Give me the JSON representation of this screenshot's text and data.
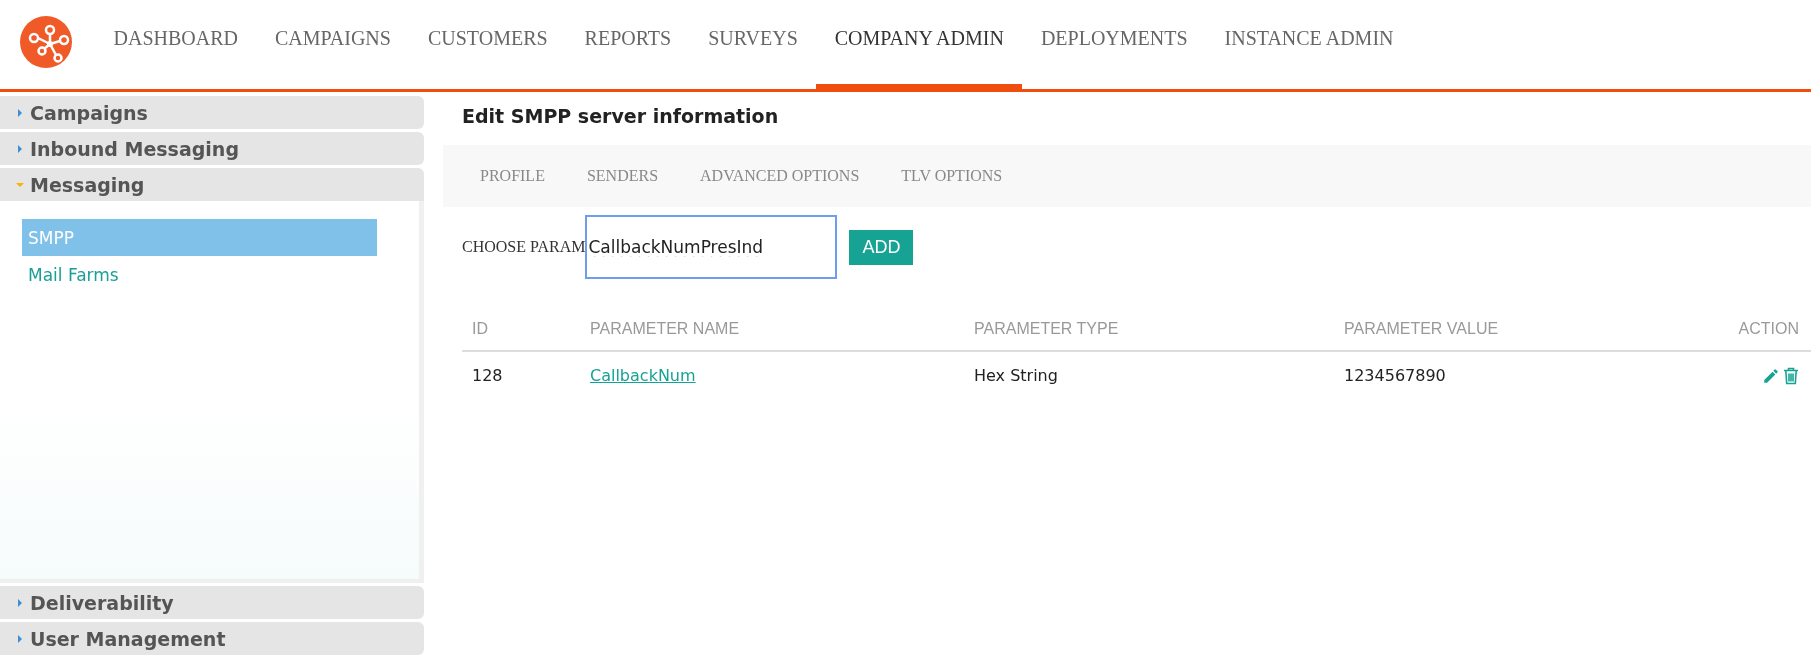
{
  "nav": {
    "items": [
      {
        "label": "DASHBOARD",
        "selected": false
      },
      {
        "label": "CAMPAIGNS",
        "selected": false
      },
      {
        "label": "CUSTOMERS",
        "selected": false
      },
      {
        "label": "REPORTS",
        "selected": false
      },
      {
        "label": "SURVEYS",
        "selected": false
      },
      {
        "label": "COMPANY ADMIN",
        "selected": true
      },
      {
        "label": "DEPLOYMENTS",
        "selected": false
      },
      {
        "label": "INSTANCE ADMIN",
        "selected": false
      }
    ]
  },
  "sidebar": {
    "sections": [
      {
        "label": "Campaigns",
        "expanded": false
      },
      {
        "label": "Inbound Messaging",
        "expanded": false
      },
      {
        "label": "Messaging",
        "expanded": true,
        "items": [
          {
            "label": "SMPP",
            "selected": true
          },
          {
            "label": "Mail Farms",
            "selected": false
          }
        ]
      },
      {
        "label": "Deliverability",
        "expanded": false
      },
      {
        "label": "User Management",
        "expanded": false
      }
    ]
  },
  "main": {
    "title": "Edit SMPP server information",
    "tabs": [
      {
        "label": "PROFILE",
        "selected": false
      },
      {
        "label": "SENDERS",
        "selected": false
      },
      {
        "label": "ADVANCED OPTIONS",
        "selected": false
      },
      {
        "label": "TLV OPTIONS",
        "selected": false
      }
    ],
    "param_label": "CHOOSE PARAM",
    "param_value": "CallbackNumPresInd",
    "add_button": "ADD",
    "table": {
      "columns": [
        "ID",
        "PARAMETER NAME",
        "PARAMETER TYPE",
        "PARAMETER VALUE",
        "ACTION"
      ],
      "rows": [
        {
          "id": "128",
          "name": "CallbackNum",
          "type": "Hex String",
          "value": "1234567890"
        }
      ]
    }
  }
}
